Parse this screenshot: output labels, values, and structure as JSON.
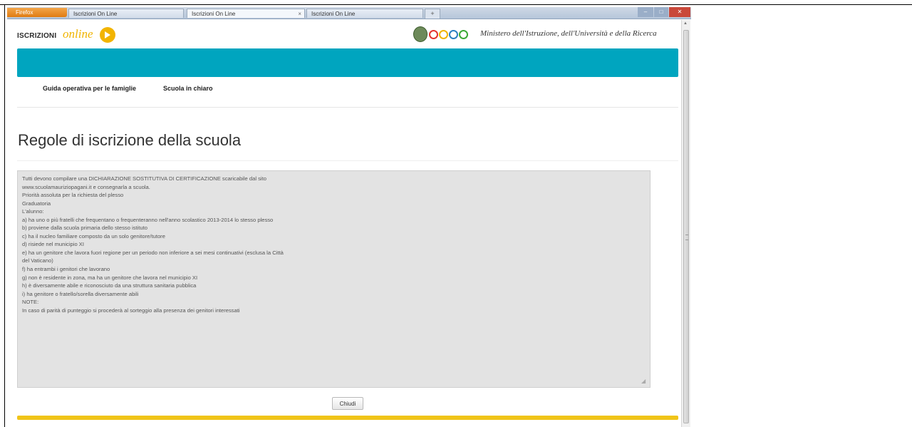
{
  "browser": {
    "app_button": "Firefox",
    "tabs": [
      {
        "label": "Iscrizioni On Line"
      },
      {
        "label": "Iscrizioni On Line"
      },
      {
        "label": "Iscrizioni On Line"
      }
    ],
    "new_tab_icon": "+",
    "window_controls": [
      "minimize",
      "maximize",
      "close"
    ]
  },
  "header": {
    "logo_prefix": "ISCRIZIONI",
    "logo_suffix": "online",
    "ministry_name": "Ministero dell'Istruzione, dell'Università e della Ricerca",
    "dot_colors": [
      "#e5322d",
      "#f0b400",
      "#2a7fc1",
      "#3aa935"
    ],
    "bar_color": "#00a5bf"
  },
  "nav": {
    "items": [
      {
        "label": "Guida operativa per le famiglie"
      },
      {
        "label": "Scuola in chiaro"
      }
    ]
  },
  "page": {
    "title": "Regole di iscrizione della scuola",
    "rules_text": "Tutti devono compilare una DICHIARAZIONE SOSTITUTIVA DI CERTIFICAZIONE scaricabile dal sito\nwww.scuolamauriziopagani.it e consegnarla a scuola.\nPriorità assoluta per la richiesta del plesso\nGraduatoria\nL'alunno:\na) ha uno o più fratelli che frequentano o frequenteranno nell'anno scolastico 2013-2014 lo stesso plesso\nb) proviene dalla scuola primaria dello stesso istituto\nc) ha il nucleo familiare composto da un solo genitore/tutore\nd) risiede nel municipio XI\ne) ha un genitore che lavora fuori regione per un periodo non inferiore a sei mesi continuativi (esclusa la Città\ndel Vaticano)\nf) ha entrambi i genitori che lavorano\ng) non è residente in zona, ma ha un genitore che lavora nel municipio XI\nh) è diversamente abile e riconosciuto da una struttura sanitaria pubblica\ni) ha genitore o fratello/sorella diversamente abili\nNOTE:\nIn caso di parità di punteggio si procederà al sorteggio alla presenza dei genitori interessati",
    "close_label": "Chiudi",
    "footer_color": "#f0c419"
  }
}
